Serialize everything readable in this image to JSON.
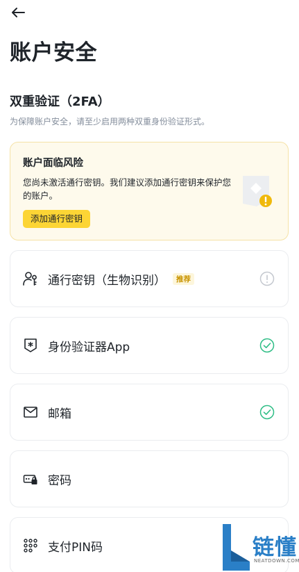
{
  "page": {
    "title": "账户安全"
  },
  "section": {
    "title": "双重验证（2FA）",
    "description": "为保障账户安全，请至少启用两种双重身份验证形式。"
  },
  "risk_card": {
    "title": "账户面临风险",
    "text": "您尚未激活通行密钥。我们建议添加通行密钥来保护您的账户。",
    "button_label": "添加通行密钥"
  },
  "options": [
    {
      "label": "通行密钥（生物识别）",
      "badge": "推荐",
      "icon": "person-key-icon",
      "status": "warning"
    },
    {
      "label": "身份验证器App",
      "icon": "authenticator-shield-icon",
      "status": "enabled"
    },
    {
      "label": "邮箱",
      "icon": "mail-icon",
      "status": "enabled"
    },
    {
      "label": "密码",
      "icon": "password-lock-icon",
      "status": "none"
    },
    {
      "label": "支付PIN码",
      "icon": "pin-grid-icon",
      "status": "none"
    }
  ],
  "watermark": {
    "text": "链懂",
    "sub": "NEATDOWN.COM"
  },
  "colors": {
    "brand_yellow": "#fcd535",
    "success_green": "#2ebd85",
    "warning_bg": "#fefaec",
    "text_primary": "#1e2329",
    "text_secondary": "#848e9c"
  }
}
